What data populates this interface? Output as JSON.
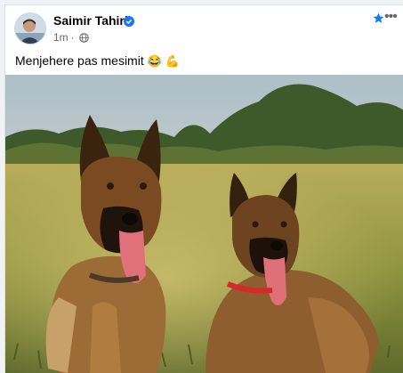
{
  "post": {
    "author": "Saimir Tahiri",
    "time": "1m",
    "separator": "·",
    "caption_text": "Menjehere pas mesimit",
    "caption_emoji_1": "😂",
    "caption_emoji_2": "💪",
    "more_label": "•••",
    "icons": {
      "verified": "verified-badge-icon",
      "audience": "globe-icon",
      "favorite": "star-icon",
      "more": "more-options-icon"
    },
    "colors": {
      "accent": "#1877f2",
      "meta": "#65676b"
    }
  }
}
